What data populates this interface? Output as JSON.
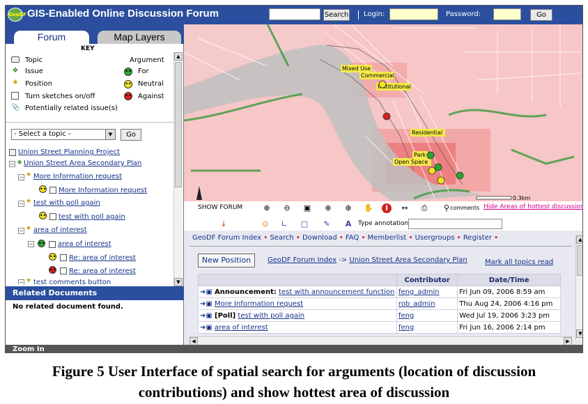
{
  "app": {
    "title": "GIS-Enabled Online Discussion Forum",
    "logo_text": "GeoDF"
  },
  "topbar": {
    "search_label": "Search",
    "login_label": "Login:",
    "password_label": "Password:",
    "go_label": "Go"
  },
  "tabs": {
    "forum": "Forum",
    "map_layers": "Map Layers"
  },
  "key": {
    "title": "KEY",
    "argument_header": "Argument",
    "topic": "Topic",
    "issue": "Issue",
    "position": "Position",
    "sketches": "Turn sketches on/off",
    "related": "Potentially related issue(s)",
    "for": "For",
    "neutral": "Neutral",
    "against": "Against"
  },
  "topic_select": {
    "value": "- Select a topic -",
    "go_label": "Go"
  },
  "tree": {
    "project": "Union Street Planning Project",
    "plan": "Union Street Area Secondary Plan",
    "item1": "More Information request",
    "item1_child": "More Information request",
    "item2": "test with poll again",
    "item2_child": "test with poll again",
    "item3": "area of interest",
    "item3_child": "area of interest",
    "item3_reply1": "Re: area of interest",
    "item3_reply2": "Re: area of interest",
    "item4": "test comments button"
  },
  "related_docs": {
    "header": "Related Documents",
    "text": "No related document found."
  },
  "status": {
    "text": "Zoom In"
  },
  "map": {
    "labels": {
      "mixed_use": "Mixed Use",
      "commercial": "Commercial",
      "institutional": "Institutional",
      "residential": "Residential",
      "park": "Park",
      "open_space": "Open Space",
      "scale": "0.3km"
    }
  },
  "toolbar": {
    "show_forum": "SHOW FORUM",
    "comments": "comments",
    "hide_hottest": "Hide Areas of hottest discussion",
    "type_annotation": "Type annotation"
  },
  "forum": {
    "nav": [
      "GeoDF Forum Index",
      "Search",
      "Download",
      "FAQ",
      "Memberlist",
      "Usergroups",
      "Register"
    ],
    "new_position": "New Position",
    "breadcrumb_index": "GeoDF Forum Index",
    "breadcrumb_arrow": "->",
    "breadcrumb_plan": "Union Street Area Secondary Plan",
    "mark_all": "Mark all topics read",
    "col_contributor": "Contributor",
    "col_datetime": "Date/Time",
    "rows": [
      {
        "prefix": "Announcement:",
        "title": "test with announcement function",
        "contributor": "feng_admin",
        "datetime": "Fri Jun 09, 2006 8:59 am"
      },
      {
        "prefix": "",
        "title": "More Information request",
        "contributor": "rob_admin",
        "datetime": "Thu Aug 24, 2006 4:16 pm"
      },
      {
        "prefix": "[Poll]",
        "title": "test with poll again",
        "contributor": "feng",
        "datetime": "Wed Jul 19, 2006 3:23 pm"
      },
      {
        "prefix": "",
        "title": "area of interest",
        "contributor": "feng",
        "datetime": "Fri Jun 16, 2006 2:14 pm"
      }
    ]
  },
  "caption": {
    "line1": "Figure 5 User Interface of spatial search for arguments (location of discussion",
    "line2": "contributions) and show hottest area of discussion"
  },
  "colors": {
    "header_blue": "#2b4f9e",
    "for": "#2aa52a",
    "neutral": "#f2e21c",
    "against": "#d42020",
    "link": "#14328a"
  }
}
